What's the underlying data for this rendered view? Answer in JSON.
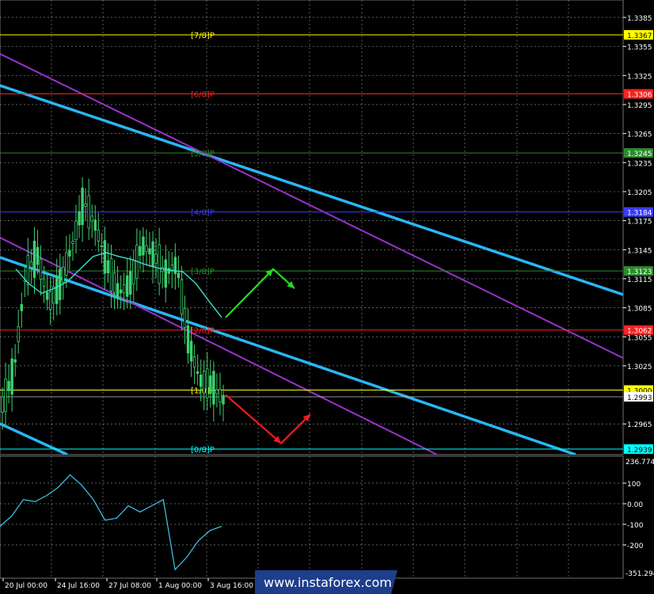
{
  "chart_data": [
    {
      "type": "line",
      "panel": "price",
      "ylim": [
        1.2915,
        1.34
      ],
      "grid": true,
      "y_ticks": [
        1.3385,
        1.3355,
        1.3325,
        1.3295,
        1.3265,
        1.3235,
        1.3205,
        1.3175,
        1.3145,
        1.3115,
        1.3085,
        1.3055,
        1.3025,
        1.2965
      ],
      "murrey_levels": [
        {
          "label": "[7/8]P",
          "value": 1.3367,
          "value_label": "1.3367",
          "color": "#ffff00"
        },
        {
          "label": "[6/8]P",
          "value": 1.3306,
          "value_label": "1.3306",
          "color": "#ff2020"
        },
        {
          "label": "[5/8]P",
          "value": 1.3245,
          "value_label": "1.3245",
          "color": "#2e8b2e"
        },
        {
          "label": "[4/8]P",
          "value": 1.3184,
          "value_label": "1.3184",
          "color": "#3a3aff"
        },
        {
          "label": "[3/8]P",
          "value": 1.3123,
          "value_label": "1.3123",
          "color": "#2e8b2e"
        },
        {
          "label": "[2/8]P",
          "value": 1.3062,
          "value_label": "1.3062",
          "color": "#ff2020"
        },
        {
          "label": "[1/8]P",
          "value": 1.3,
          "value_label": "1.3000",
          "color": "#ffff00"
        },
        {
          "label": "[0/8]P",
          "value": 1.2939,
          "value_label": "1.2939",
          "color": "#00ffff"
        }
      ],
      "current_price": {
        "value": 1.2993,
        "value_label": "1.2993"
      },
      "moving_average": {
        "x": [
          0,
          1,
          2,
          3,
          4,
          5,
          6,
          7,
          8,
          9,
          10,
          11,
          12,
          13,
          14,
          15,
          16
        ],
        "y": [
          1.3125,
          1.311,
          1.31,
          1.3105,
          1.3112,
          1.3125,
          1.3138,
          1.3142,
          1.3138,
          1.3135,
          1.313,
          1.3126,
          1.3124,
          1.3122,
          1.311,
          1.3092,
          1.3075
        ]
      },
      "price_series": {
        "x": [
          0,
          1,
          2,
          3,
          4,
          5,
          6,
          7,
          8,
          9,
          10,
          11,
          12,
          13,
          14,
          15,
          16,
          17,
          18,
          19
        ],
        "y": [
          1.2985,
          1.302,
          1.312,
          1.314,
          1.309,
          1.311,
          1.315,
          1.3195,
          1.317,
          1.313,
          1.31,
          1.311,
          1.315,
          1.314,
          1.312,
          1.313,
          1.305,
          1.301,
          1.3005,
          1.299
        ]
      },
      "scenario_arrows": [
        {
          "color": "#22dd22",
          "points": [
            [
              1.3075,
              0
            ],
            [
              1.3125,
              1
            ],
            [
              1.3105,
              2
            ]
          ]
        },
        {
          "color": "#ff1a1a",
          "points": [
            [
              1.2995,
              0
            ],
            [
              1.2945,
              1
            ],
            [
              1.2975,
              2
            ]
          ]
        }
      ]
    },
    {
      "type": "line",
      "panel": "oscillator",
      "ylim": [
        -351.2941,
        236.7745
      ],
      "y_ticks": [
        100,
        0.0,
        -100,
        -200
      ],
      "y_tick_labels": [
        "100",
        "0.00",
        "-100",
        "-200"
      ],
      "top_label": "236.7745",
      "bottom_label": "-351.294",
      "series": {
        "x": [
          0,
          1,
          2,
          3,
          4,
          5,
          6,
          7,
          8,
          9,
          10,
          11,
          12,
          13,
          14,
          15,
          16,
          17,
          18,
          19
        ],
        "y": [
          -110,
          -60,
          20,
          10,
          40,
          80,
          140,
          90,
          20,
          -80,
          -70,
          -10,
          -40,
          -10,
          20,
          -320,
          -260,
          -180,
          -130,
          -110
        ]
      }
    }
  ],
  "x_ticks": [
    "20 Jul 00:00",
    "24 Jul 16:00",
    "27 Jul 08:00",
    "1 Aug 00:00",
    "3 Aug 16:00"
  ],
  "watermark": "www.instaforex.com"
}
